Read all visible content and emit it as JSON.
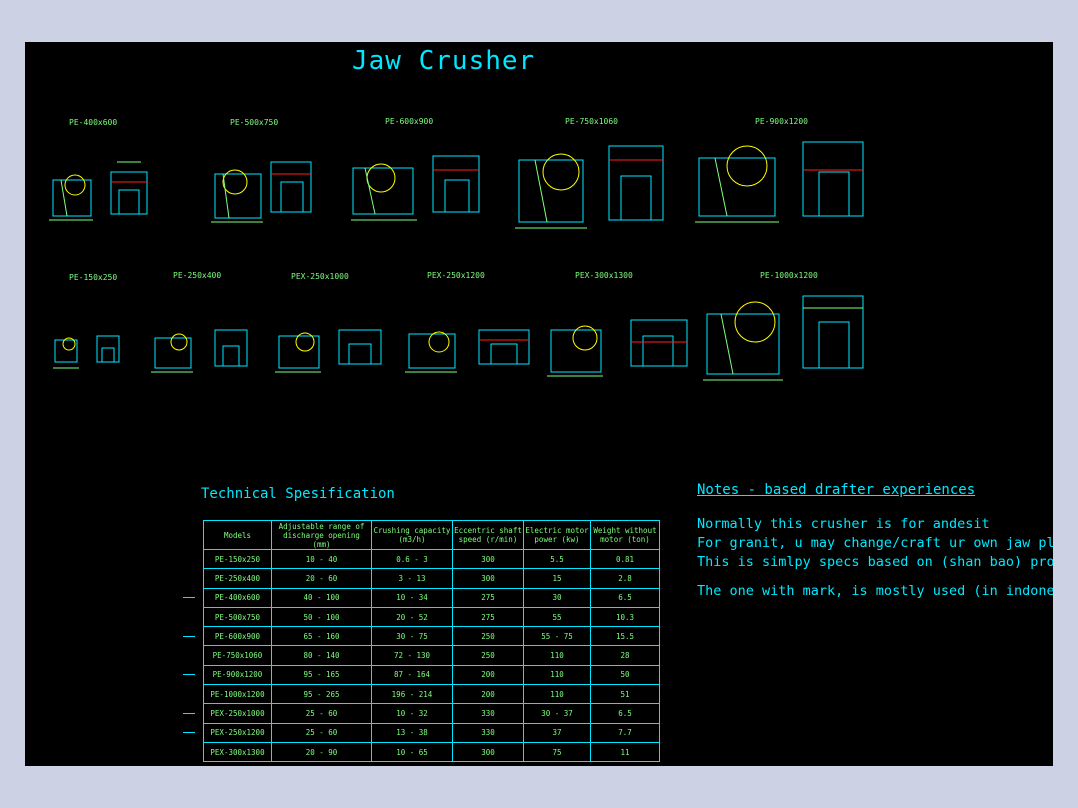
{
  "title": "Jaw Crusher",
  "models_row1": [
    "PE-400x600",
    "PE-500x750",
    "PE-600x900",
    "PE-750x1060",
    "PE-900x1200"
  ],
  "models_row2": [
    "PE-150x250",
    "PE-250x400",
    "PEX-250x1000",
    "PEX-250x1200",
    "PEX-300x1300",
    "PE-1000x1200"
  ],
  "table": {
    "title": "Technical Spesification",
    "headers": [
      "Models",
      "Adjustable range of discharge opening (mm)",
      "Crushing capacity (m3/h)",
      "Eccentric shaft speed (r/min)",
      "Electric motor power (kw)",
      "Weight without motor (ton)"
    ],
    "rows": [
      [
        "PE-150x250",
        "10 - 40",
        "0.6 - 3",
        "300",
        "5.5",
        "0.81"
      ],
      [
        "PE-250x400",
        "20 - 60",
        "3 - 13",
        "300",
        "15",
        "2.8"
      ],
      [
        "PE-400x600",
        "40 - 100",
        "10 - 34",
        "275",
        "30",
        "6.5"
      ],
      [
        "PE-500x750",
        "50 - 100",
        "20 - 52",
        "275",
        "55",
        "10.3"
      ],
      [
        "PE-600x900",
        "65 - 160",
        "30 - 75",
        "250",
        "55 - 75",
        "15.5"
      ],
      [
        "PE-750x1060",
        "80 - 140",
        "72 - 130",
        "250",
        "110",
        "28"
      ],
      [
        "PE-900x1200",
        "95 - 165",
        "87 - 164",
        "200",
        "110",
        "50"
      ],
      [
        "PE-1000x1200",
        "95 - 265",
        "196 - 214",
        "200",
        "110",
        "51"
      ],
      [
        "PEX-250x1000",
        "25 - 60",
        "10 - 32",
        "330",
        "30 - 37",
        "6.5"
      ],
      [
        "PEX-250x1200",
        "25 - 60",
        "13 - 38",
        "330",
        "37",
        "7.7"
      ],
      [
        "PEX-300x1300",
        "20 - 90",
        "10 - 65",
        "300",
        "75",
        "11"
      ]
    ],
    "marked": [
      false,
      false,
      true,
      false,
      true,
      false,
      true,
      false,
      true,
      true,
      false
    ]
  },
  "notes": {
    "title": "Notes - based drafter experiences",
    "lines": [
      "Normally this crusher is for andesit",
      "For granit, u may change/craft ur own jaw plate",
      "This is simlpy specs based on (shan bao) product",
      "The one with mark, is mostly used (in indonesia)"
    ]
  },
  "colors": {
    "background": "#000000",
    "frame": "#cdd1e4",
    "cyan": "#00e8ff",
    "green": "#7dff7d",
    "yellow": "#ffff00",
    "red": "#ff2020"
  }
}
